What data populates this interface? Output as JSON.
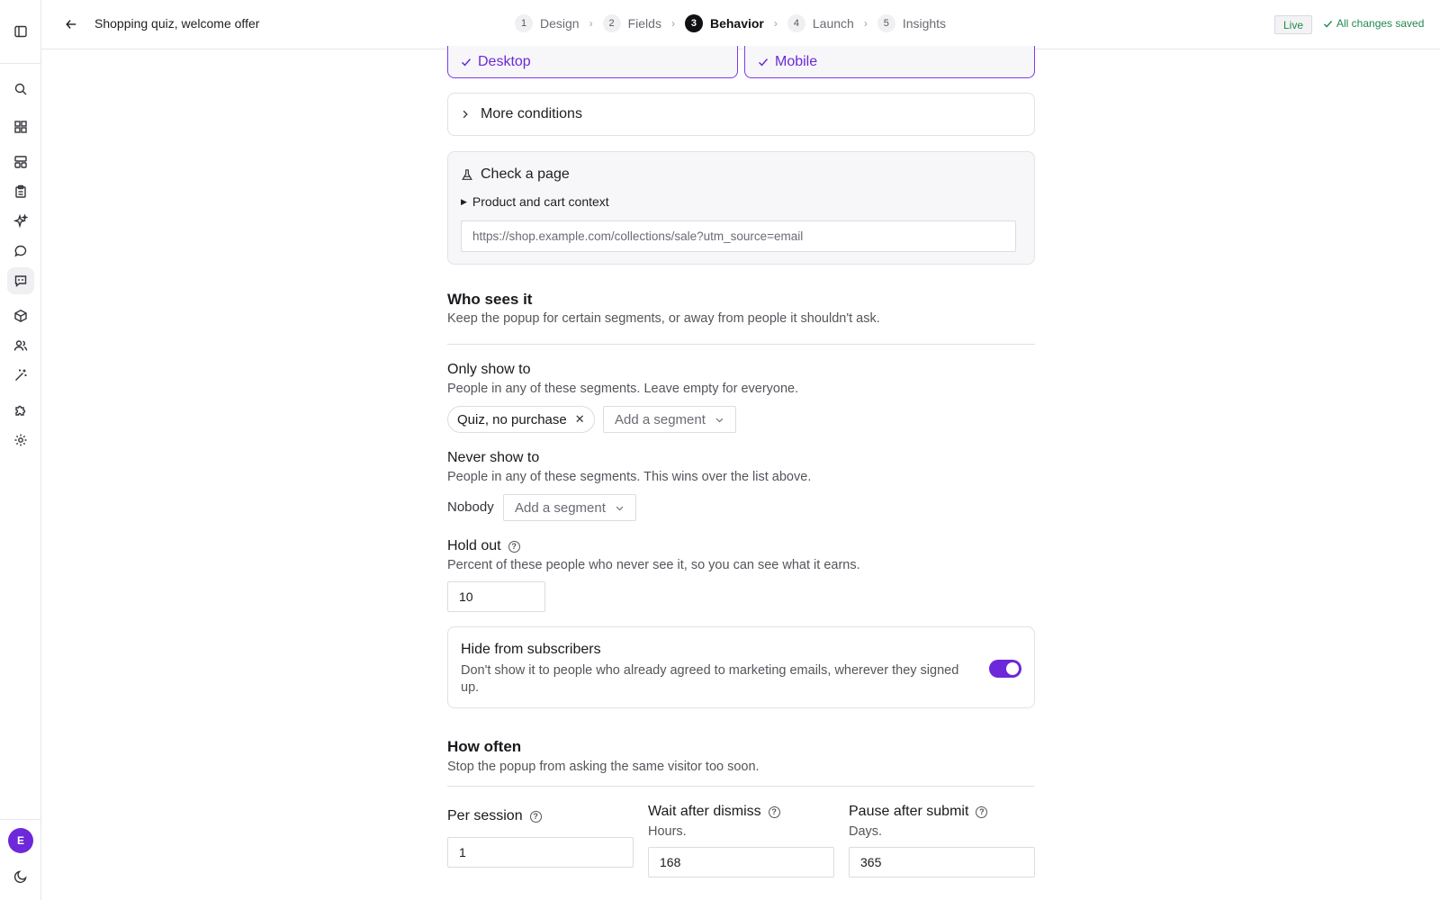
{
  "header": {
    "title": "Shopping quiz, welcome offer",
    "steps": [
      {
        "num": "1",
        "label": "Design"
      },
      {
        "num": "2",
        "label": "Fields"
      },
      {
        "num": "3",
        "label": "Behavior"
      },
      {
        "num": "4",
        "label": "Launch"
      },
      {
        "num": "5",
        "label": "Insights"
      }
    ],
    "active_step": "Behavior",
    "status_badge": "Live",
    "save_status": "All changes saved"
  },
  "sidebar": {
    "icons": [
      "panel-toggle-icon",
      "search-icon",
      "dashboard-icon",
      "layout-icon",
      "clipboard-icon",
      "sparkle-icon",
      "chat-icon",
      "message-square-icon",
      "box-icon",
      "users-icon",
      "magic-wand-icon",
      "puzzle-icon",
      "gear-icon"
    ],
    "active_icon": "message-square-icon",
    "avatar_initial": "E",
    "theme_icon": "moon-icon"
  },
  "devices": {
    "desktop_label": "Desktop",
    "mobile_label": "Mobile",
    "desktop_checked": true,
    "mobile_checked": true
  },
  "more_conditions": {
    "label": "More conditions"
  },
  "check_page": {
    "title": "Check a page",
    "context_toggle": "Product and cart context",
    "url_placeholder": "https://shop.example.com/collections/sale?utm_source=email"
  },
  "who_sees": {
    "title": "Who sees it",
    "description": "Keep the popup for certain segments, or away from people it shouldn't ask.",
    "only_show": {
      "label": "Only show to",
      "description": "People in any of these segments. Leave empty for everyone.",
      "chips": [
        "Quiz, no purchase"
      ],
      "add_placeholder": "Add a segment"
    },
    "never_show": {
      "label": "Never show to",
      "description": "People in any of these segments. This wins over the list above.",
      "empty_text": "Nobody",
      "add_placeholder": "Add a segment"
    },
    "hold_out": {
      "label": "Hold out",
      "description": "Percent of these people who never see it, so you can see what it earns.",
      "value": "10"
    },
    "hide_subscribers": {
      "title": "Hide from subscribers",
      "description": "Don't show it to people who already agreed to marketing emails, wherever they signed up.",
      "enabled": true
    }
  },
  "how_often": {
    "title": "How often",
    "description": "Stop the popup from asking the same visitor too soon.",
    "per_session": {
      "label": "Per session",
      "value": "1"
    },
    "wait_dismiss": {
      "label": "Wait after dismiss",
      "unit": "Hours.",
      "value": "168"
    },
    "pause_submit": {
      "label": "Pause after submit",
      "unit": "Days.",
      "value": "365"
    }
  },
  "colors": {
    "accent": "#6d28d9",
    "success": "#1f8a4c"
  }
}
